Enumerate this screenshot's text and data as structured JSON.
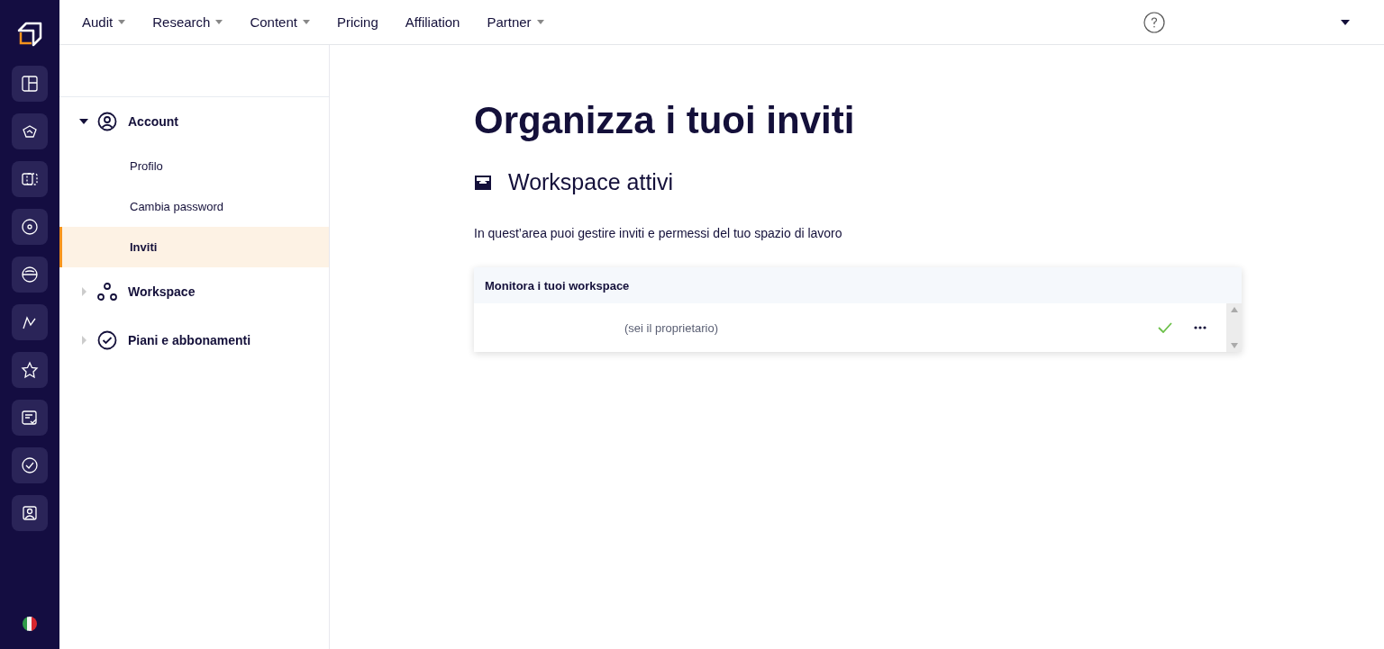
{
  "top_nav": [
    {
      "label": "Audit",
      "dropdown": true
    },
    {
      "label": "Research",
      "dropdown": true
    },
    {
      "label": "Content",
      "dropdown": true
    },
    {
      "label": "Pricing",
      "dropdown": false
    },
    {
      "label": "Affiliation",
      "dropdown": false
    },
    {
      "label": "Partner",
      "dropdown": true
    }
  ],
  "sidebar": {
    "items": [
      {
        "label": "Account",
        "kind": "account",
        "expanded": true,
        "children": [
          {
            "label": "Profilo",
            "selected": false
          },
          {
            "label": "Cambia password",
            "selected": false
          },
          {
            "label": "Inviti",
            "selected": true
          }
        ]
      },
      {
        "label": "Workspace",
        "kind": "workspace",
        "expanded": false
      },
      {
        "label": "Piani e abbonamenti",
        "kind": "plans",
        "expanded": false
      }
    ]
  },
  "page": {
    "title": "Organizza i tuoi inviti",
    "section_title": "Workspace attivi",
    "description": "In quest’area puoi gestire inviti e permessi del tuo spazio di lavoro"
  },
  "table": {
    "header": "Monitora i tuoi workspace",
    "rows": [
      {
        "text": "(sei il proprietario)",
        "active": true
      }
    ]
  }
}
